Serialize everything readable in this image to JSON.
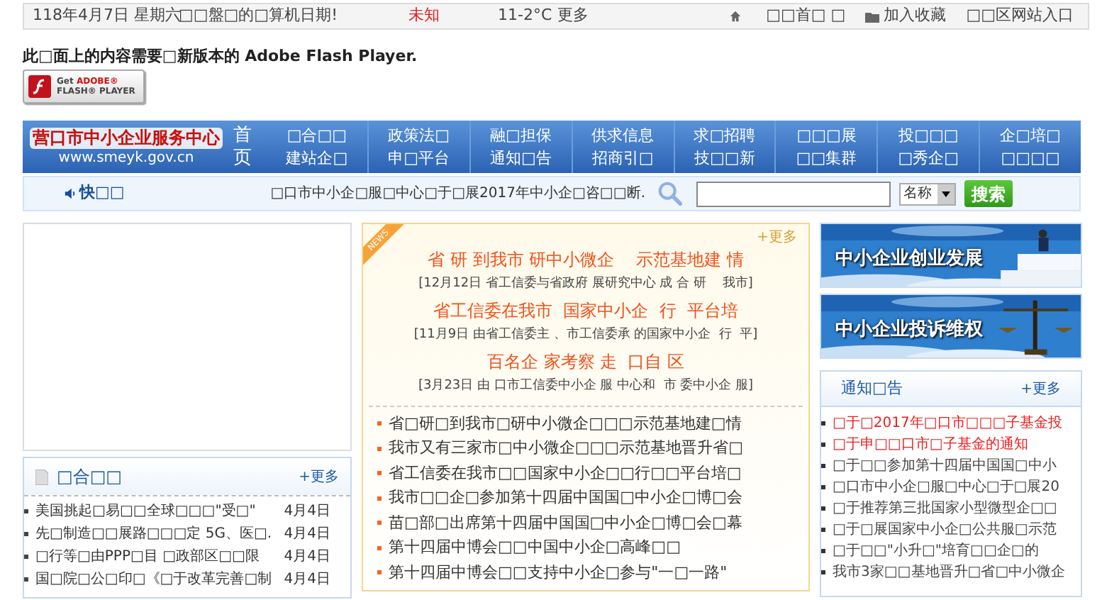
{
  "top_bar": {
    "date": "118年4月7日 星期六",
    "message": "□□盤□的□算机日期!",
    "weather": "未知",
    "temperature": "11-2°C",
    "more": "更多",
    "links": [
      {
        "label": "□□首□ □"
      },
      {
        "label": "加入收藏"
      },
      {
        "label": "□□区网站入口"
      }
    ]
  },
  "flash_notice": {
    "text": "此□面上的内容需要□新版本的 Adobe Flash Player.",
    "button_get": "Get",
    "button_brand": "ADOBE®",
    "button_product": "FLASH® PLAYER"
  },
  "header": {
    "logo": "营口市中小企业服务中心",
    "url": "www.smeyk.gov.cn",
    "home": "首页",
    "menu": [
      {
        "lines": [
          "□合□□",
          "建站企□"
        ]
      },
      {
        "lines": [
          "政策法□",
          "申□平台"
        ]
      },
      {
        "lines": [
          "融□担保",
          "通知□告"
        ]
      },
      {
        "lines": [
          "供求信息",
          "招商引□"
        ]
      },
      {
        "lines": [
          "求□招聘",
          "技□□新"
        ]
      },
      {
        "lines": [
          "□□□展",
          "□□集群"
        ]
      },
      {
        "lines": [
          "投□□□",
          "□秀企□"
        ]
      },
      {
        "lines": [
          "企□培□",
          "□□□□"
        ]
      }
    ]
  },
  "quick_bar": {
    "label": "快□□",
    "ticker": "□口市中小企□服□中心□于□展2017年中小企□咨□□断.",
    "search_scope": "名称",
    "search_button": "搜索"
  },
  "left_panel": {
    "title": "□合□□",
    "more": "+更多",
    "items": [
      {
        "title": "美国挑起□易□□全球□□□\"受□\"",
        "date": "4月4日"
      },
      {
        "title": "先□制造□□展路□□□定 5G、医□.",
        "date": "4月4日"
      },
      {
        "title": "□行等□由PPP□目 □政部区□□限",
        "date": "4月4日"
      },
      {
        "title": "国□院□公□印□《□于改革完善□制",
        "date": "4月4日"
      }
    ]
  },
  "news": {
    "badge": "NEWS",
    "more": "+更多",
    "stories": [
      {
        "headline": "省 研 到我市 研中小微企    示范基地建 情",
        "summary": "[12月12日 省工信委与省政府 展研究中心 成 合 研    我市]"
      },
      {
        "headline": "省工信委在我市  国家中小企  行  平台培",
        "summary": "[11月9日 由省工信委主 、市工信委承 的国家中小企  行  平]"
      },
      {
        "headline": "百名企 家考察 走  口自 区",
        "summary": "[3月23日 由 口市工信委中小企 服 中心和  市 委中小企 服]"
      }
    ],
    "items": [
      "省□研□到我市□研中小微企□□□示范基地建□情",
      "我市又有三家市□中小微企□□□示范基地晋升省□",
      "省工信委在我市□□国家中小企□□行□□平台培□",
      "我市□□企□参加第十四届中国国□中小企□博□会",
      "苗□部□出席第十四届中国国□中小企□博□会□幕",
      "第十四届中博会□□中国中小企□高峰□□",
      "第十四届中博会□□支持中小企□参与\"一□一路\""
    ]
  },
  "banners": [
    {
      "kind": "picture",
      "caption": "中小企业创业发展"
    },
    {
      "kind": "picture",
      "caption": "中小企业投诉维权"
    }
  ],
  "notices": {
    "title": "通知□告",
    "more": "+更多",
    "items": [
      {
        "text": "□于□2017年□口市□□□子基金投",
        "highlighted": true
      },
      {
        "text": "□于申□□口市□子基金的通知",
        "highlighted": true
      },
      {
        "text": "□于□□参加第十四届中国国□中小",
        "highlighted": false
      },
      {
        "text": "□口市中小企□服□中心□于□展20",
        "highlighted": false
      },
      {
        "text": "□于推荐第三批国家小型微型企□□",
        "highlighted": false
      },
      {
        "text": "□于□展国家中小企□公共服□示范",
        "highlighted": false
      },
      {
        "text": "□于□□\"小升□\"培育□□企□的",
        "highlighted": false
      },
      {
        "text": "我市3家□□基地晋升□省□中小微企",
        "highlighted": false
      }
    ]
  }
}
